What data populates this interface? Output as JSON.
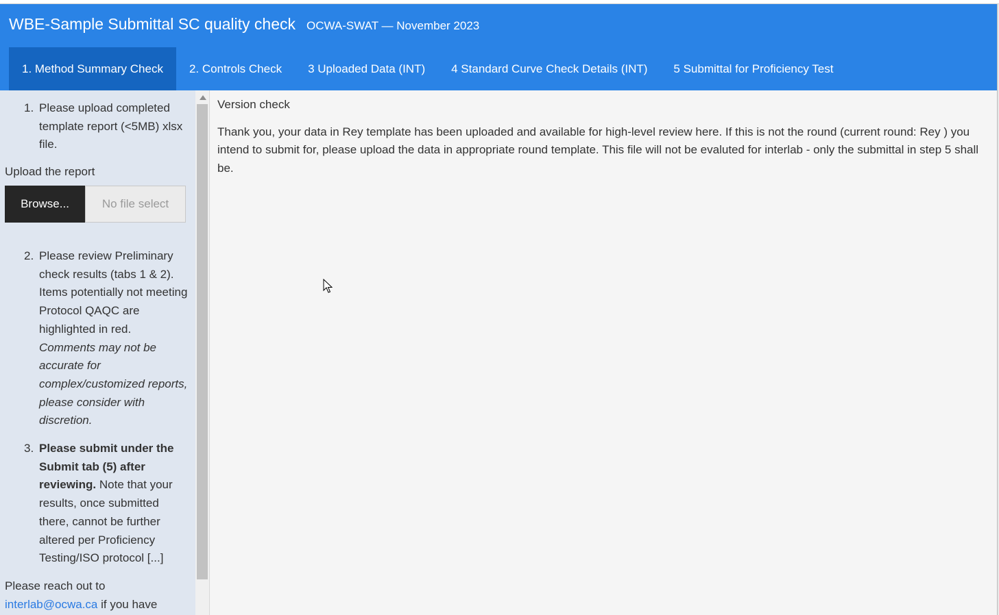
{
  "header": {
    "title": "WBE-Sample Submittal SC quality check",
    "subtitle": "OCWA-SWAT — November 2023"
  },
  "tabs": [
    {
      "label": "1. Method Summary Check",
      "active": true
    },
    {
      "label": "2. Controls Check",
      "active": false
    },
    {
      "label": "3 Uploaded Data (INT)",
      "active": false
    },
    {
      "label": "4 Standard Curve Check Details (INT)",
      "active": false
    },
    {
      "label": "5 Submittal for Proficiency Test",
      "active": false
    }
  ],
  "sidebar": {
    "step1": {
      "num": "1.",
      "text": "Please upload completed template report (<5MB) xlsx file."
    },
    "upload_label": "Upload the report",
    "browse_label": "Browse...",
    "file_status": "No file select",
    "step2": {
      "num": "2.",
      "text": "Please review Preliminary check results (tabs 1 & 2). Items potentially not meeting Protocol QAQC are highlighted in red.",
      "italic": "Comments may not be accurate for complex/customized reports, please consider with discretion."
    },
    "step3": {
      "num": "3.",
      "bold": "Please submit under the Submit tab (5) after reviewing.",
      "text": " Note that your results, once submitted there, cannot be further altered per Proficiency Testing/ISO protocol [...]"
    },
    "reach_prefix": "Please reach out to",
    "email": "interlab@ocwa.ca",
    "reach_suffix": " if you have"
  },
  "main": {
    "heading": "Version check",
    "message": "Thank you, your data in Rey template has been uploaded and available for high-level review here. If this is not the round (current round: Rey ) you intend to submit for, please upload the data in appropriate round template. This file will not be evaluted for interlab - only the submittal in step 5 shall be."
  },
  "colors": {
    "navbar": "#2a83e6",
    "active_tab": "#1565c0",
    "sidebar_bg": "#dfe6f0",
    "browse_bg": "#262626",
    "link": "#2a7ae2"
  },
  "icons": {
    "cursor": "mouse-pointer-icon",
    "scroll_up": "scroll-up-arrow-icon"
  }
}
